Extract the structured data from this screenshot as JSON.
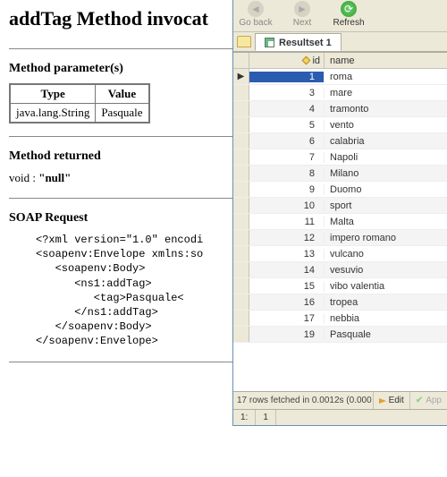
{
  "left": {
    "title": "addTag Method invocat",
    "params_heading": "Method parameter(s)",
    "param_table": {
      "headers": [
        "Type",
        "Value"
      ],
      "row": [
        "java.lang.String",
        "Pasquale"
      ]
    },
    "returned_heading": "Method returned",
    "returned_prefix": "void : ",
    "returned_value": "\"null\"",
    "soap_heading": "SOAP Request",
    "soap_lines": [
      "<?xml version=\"1.0\" encodi",
      "<soapenv:Envelope xmlns:so",
      "   <soapenv:Body>",
      "      <ns1:addTag>",
      "         <tag>Pasquale<",
      "      </ns1:addTag>",
      "   </soapenv:Body>",
      "</soapenv:Envelope>"
    ]
  },
  "db": {
    "toolbar": {
      "back": "Go back",
      "next": "Next",
      "refresh": "Refresh"
    },
    "tab_label": "Resultset 1",
    "columns": {
      "id": "id",
      "name": "name"
    },
    "rows": [
      {
        "id": "1",
        "name": "roma",
        "selected": true
      },
      {
        "id": "3",
        "name": "mare"
      },
      {
        "id": "4",
        "name": "tramonto"
      },
      {
        "id": "5",
        "name": "vento"
      },
      {
        "id": "6",
        "name": "calabria"
      },
      {
        "id": "7",
        "name": "Napoli"
      },
      {
        "id": "8",
        "name": "Milano"
      },
      {
        "id": "9",
        "name": "Duomo"
      },
      {
        "id": "10",
        "name": "sport"
      },
      {
        "id": "11",
        "name": "Malta"
      },
      {
        "id": "12",
        "name": "impero romano"
      },
      {
        "id": "13",
        "name": "vulcano"
      },
      {
        "id": "14",
        "name": "vesuvio"
      },
      {
        "id": "15",
        "name": "vibo valentia"
      },
      {
        "id": "16",
        "name": "tropea"
      },
      {
        "id": "17",
        "name": "nebbia"
      },
      {
        "id": "19",
        "name": "Pasquale"
      }
    ],
    "status": "17 rows fetched in 0.0012s (0.000",
    "edit_label": "Edit",
    "apply_label": "App",
    "footer": {
      "a": "1:",
      "b": "1"
    }
  }
}
